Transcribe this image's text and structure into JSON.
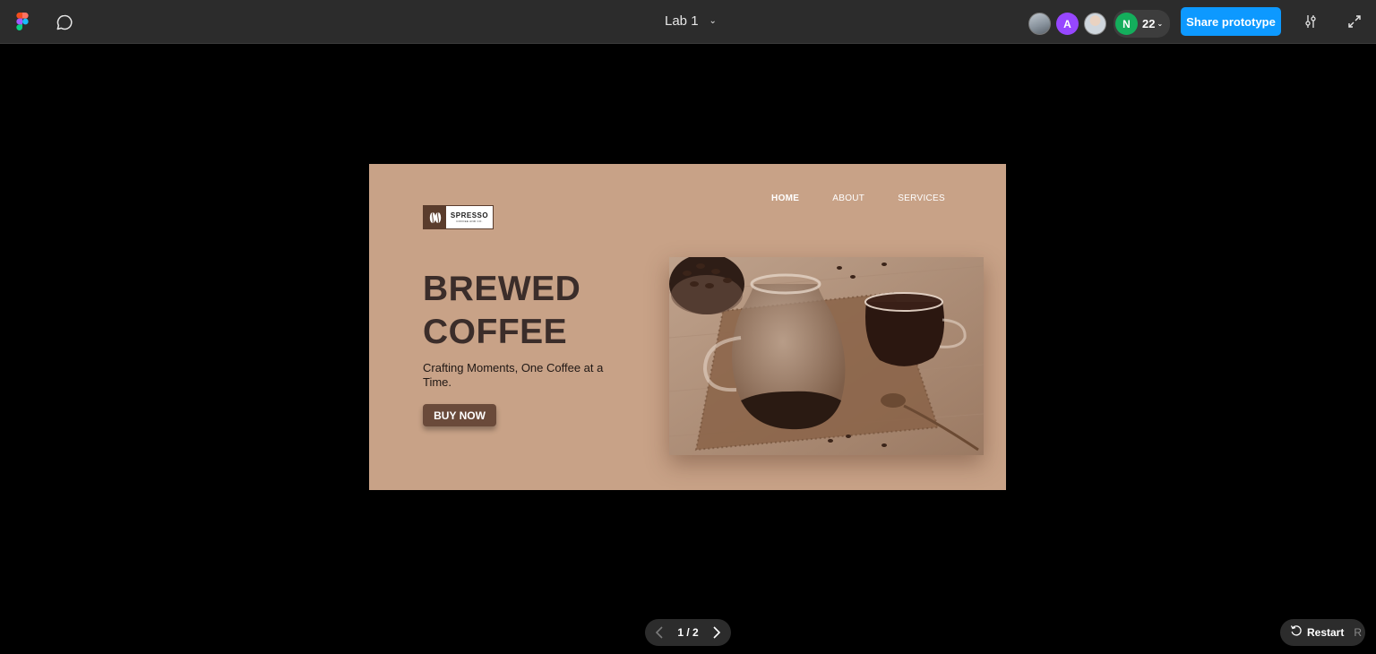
{
  "toolbar": {
    "file_title": "Lab 1",
    "avatar_a_initial": "A",
    "avatar_n_initial": "N",
    "collaborator_count": "22",
    "share_label": "Share prototype"
  },
  "prototype": {
    "logo": {
      "name": "SPRESSO",
      "subtitle": "COFFEE AND CO."
    },
    "nav": [
      {
        "label": "HOME",
        "active": true
      },
      {
        "label": "ABOUT",
        "active": false
      },
      {
        "label": "SERVICES",
        "active": false
      }
    ],
    "headline_line1": "BREWED",
    "headline_line2": "COFFEE",
    "tagline": "Crafting Moments, One Coffee at a Time.",
    "cta_label": "BUY NOW"
  },
  "footer": {
    "page_indicator": "1 / 2",
    "restart_label": "Restart",
    "restart_shortcut": "R"
  },
  "colors": {
    "toolbar_bg": "#2c2c2c",
    "share_button": "#0d99ff",
    "frame_bg": "#c8a287",
    "headline": "#3b2d2a",
    "cta_bg": "#6a4a3a"
  }
}
